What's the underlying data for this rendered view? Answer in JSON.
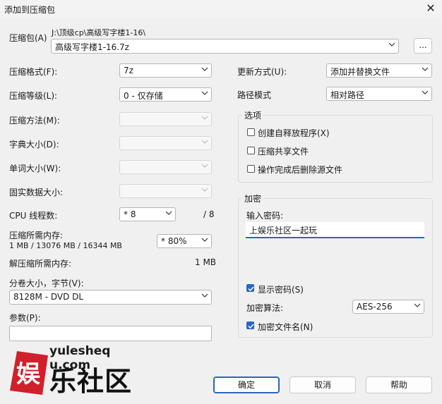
{
  "window": {
    "title": "添加到压缩包",
    "close_glyph": "✕"
  },
  "archive": {
    "label": "压缩包(A)",
    "path": "J:\\顶级cp\\高级写字楼1-16\\",
    "filename": "高级写字楼1-16.7z",
    "browse_label": "..."
  },
  "left": {
    "format": {
      "label": "压缩格式(F):",
      "value": "7z"
    },
    "level": {
      "label": "压缩等级(L):",
      "value": "0 - 仅存储"
    },
    "method": {
      "label": "压缩方法(M):",
      "value": ""
    },
    "dict": {
      "label": "字典大小(D):",
      "value": ""
    },
    "word": {
      "label": "单词大小(W):",
      "value": ""
    },
    "solid": {
      "label": "固实数据大小:",
      "value": ""
    },
    "threads": {
      "label": "CPU 线程数:",
      "value": "* 8",
      "max": "/ 8"
    },
    "mem_compress": {
      "label": "压缩所需内存:",
      "detail": "1 MB / 13076 MB / 16344 MB",
      "value": "* 80%"
    },
    "mem_decompress": {
      "label": "解压缩所需内存:",
      "value": "1 MB"
    },
    "volume": {
      "label": "分卷大小，字节(V):",
      "value": "8128M - DVD DL"
    },
    "params": {
      "label": "参数(P):",
      "value": ""
    }
  },
  "right": {
    "update": {
      "label": "更新方式(U):",
      "value": "添加并替换文件"
    },
    "pathmode": {
      "label": "路径模式",
      "value": "相对路径"
    },
    "options": {
      "title": "选项",
      "items": [
        {
          "label": "创建自释放程序(X)",
          "checked": false
        },
        {
          "label": "压缩共享文件",
          "checked": false
        },
        {
          "label": "操作完成后删除源文件",
          "checked": false
        }
      ]
    },
    "encryption": {
      "title": "加密",
      "pw_label": "输入密码:",
      "pw_value": "上娱乐社区一起玩",
      "show_pw": {
        "label": "显示密码(S)",
        "checked": true
      },
      "method_label": "加密算法:",
      "method_value": "AES-256",
      "encrypt_names": {
        "label": "加密文件名(N)",
        "checked": true
      }
    }
  },
  "buttons": {
    "ok": "确定",
    "cancel": "取消",
    "help": "帮助"
  },
  "watermark": {
    "url": "yulesheq u.com",
    "glyph": "娱",
    "text": "乐社区"
  },
  "colors": {
    "accent": "#2767c4",
    "watermark_red": "#d0202b"
  }
}
